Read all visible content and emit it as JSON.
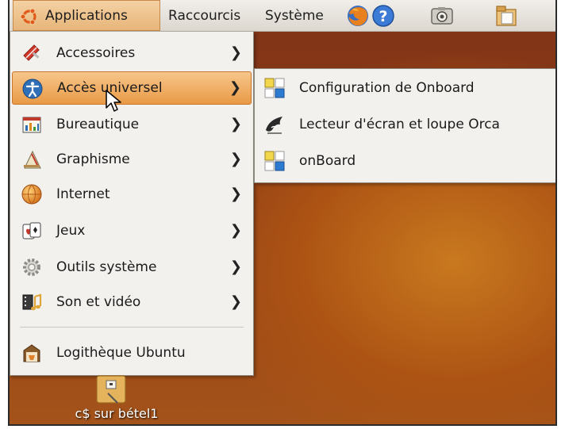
{
  "panel": {
    "applications_label": "Applications",
    "places_label": "Raccourcis",
    "system_label": "Système"
  },
  "menu": {
    "items": [
      {
        "label": "Accessoires",
        "icon": "accessories-icon"
      },
      {
        "label": "Accès universel",
        "icon": "universal-access-icon"
      },
      {
        "label": "Bureautique",
        "icon": "office-icon"
      },
      {
        "label": "Graphisme",
        "icon": "graphics-icon"
      },
      {
        "label": "Internet",
        "icon": "internet-icon"
      },
      {
        "label": "Jeux",
        "icon": "games-icon"
      },
      {
        "label": "Outils système",
        "icon": "system-tools-icon"
      },
      {
        "label": "Son et vidéo",
        "icon": "sound-video-icon"
      }
    ],
    "software_center_label": "Logithèque Ubuntu",
    "arrow": "❯"
  },
  "submenu": {
    "items": [
      {
        "label": "Configuration de Onboard",
        "icon": "onboard-settings-icon"
      },
      {
        "label": "Lecteur d'écran et loupe Orca",
        "icon": "orca-icon"
      },
      {
        "label": "onBoard",
        "icon": "onboard-icon"
      }
    ]
  },
  "desktop": {
    "icon_label": "c$ sur bétel1"
  },
  "colors": {
    "highlight": "#e99a46",
    "menu_bg": "#f3f1ee",
    "desktop": "#9a4617"
  }
}
